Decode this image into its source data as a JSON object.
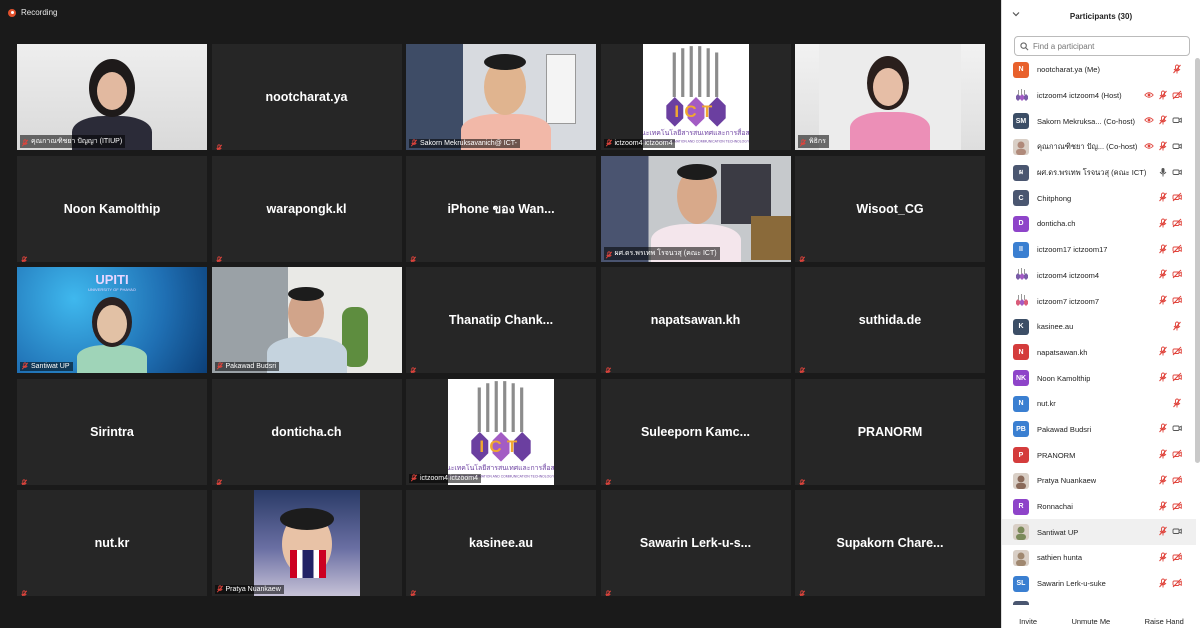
{
  "recording": {
    "label": "Recording"
  },
  "tiles": [
    {
      "name": "คุณกาณฑิชยา ปัญญา (ITIUP)",
      "kind": "video",
      "bg": "woman1"
    },
    {
      "name": "nootcharat.ya",
      "kind": "name"
    },
    {
      "name": "Sakorn Mekruksavanich@ ICT-",
      "kind": "video",
      "bg": "office"
    },
    {
      "name": "ictzoom4 ictzoom4",
      "kind": "logo"
    },
    {
      "name": "พิธิกร",
      "kind": "video",
      "bg": "woman2"
    },
    {
      "name": "Noon Kamolthip",
      "kind": "name"
    },
    {
      "name": "warapongk.kl",
      "kind": "name"
    },
    {
      "name": "iPhone ของ Wan...",
      "kind": "name"
    },
    {
      "name": "ผศ.ดร.พรเทพ โรจนวสุ (คณะ ICT)",
      "kind": "video",
      "bg": "man2",
      "active": true
    },
    {
      "name": "Wisoot_CG",
      "kind": "name"
    },
    {
      "name": "Santiwat UP",
      "kind": "video",
      "bg": "blue"
    },
    {
      "name": "Pakawad Budsri",
      "kind": "video",
      "bg": "room"
    },
    {
      "name": "Thanatip  Chank...",
      "kind": "name"
    },
    {
      "name": "napatsawan.kh",
      "kind": "name"
    },
    {
      "name": "suthida.de",
      "kind": "name"
    },
    {
      "name": "Sirintra",
      "kind": "name"
    },
    {
      "name": "donticha.ch",
      "kind": "name"
    },
    {
      "name": "ictzoom4 ictzoom4",
      "kind": "logo"
    },
    {
      "name": "Suleeporn  Kamc...",
      "kind": "name"
    },
    {
      "name": "PRANORM",
      "kind": "name"
    },
    {
      "name": "nut.kr",
      "kind": "name"
    },
    {
      "name": "Pratya Nuankaew",
      "kind": "video",
      "bg": "boy"
    },
    {
      "name": "kasinee.au",
      "kind": "name"
    },
    {
      "name": "Sawarin  Lerk-u-s...",
      "kind": "name"
    },
    {
      "name": "Supakorn  Chare...",
      "kind": "name"
    }
  ],
  "logo": {
    "letters": "ICT",
    "tagline": "คณะเทคโนโลยีสารสนเทศและการสื่อสาร",
    "sub": "SCHOOL OF INFORMATION AND COMMUNICATION TECHNOLOGY"
  },
  "upiti": {
    "title": "UPITI",
    "sub": "UNIVERSITY OF PHAYAO"
  },
  "panel": {
    "title": "Participants (30)",
    "search_placeholder": "Find a participant",
    "participants": [
      {
        "initials": "N",
        "color": "#e8612c",
        "name": "nootcharat.ya (Me)",
        "icons": [
          "mic-off"
        ]
      },
      {
        "initials": "",
        "color": "#7a5ca8",
        "name": "ictzoom4 ictzoom4 (Host)",
        "icons": [
          "eye",
          "mic-off",
          "cam-off"
        ],
        "logo": true
      },
      {
        "initials": "SM",
        "color": "#3c4e66",
        "name": "Sakorn Mekruksa... (Co-host)",
        "icons": [
          "eye",
          "mic-off",
          "cam"
        ]
      },
      {
        "initials": "",
        "color": "#b08a7a",
        "name": "คุณกาณฑิชยา ปัญ... (Co-host)",
        "icons": [
          "eye",
          "mic-off",
          "cam"
        ],
        "photo": true
      },
      {
        "initials": "ผ",
        "color": "#4a5670",
        "name": "ผศ.ดร.พรเทพ โรจนวสุ (คณะ ICT)",
        "icons": [
          "mic",
          "cam"
        ]
      },
      {
        "initials": "C",
        "color": "#4a5670",
        "name": "Chitphong",
        "icons": [
          "mic-off",
          "cam-off"
        ]
      },
      {
        "initials": "D",
        "color": "#8e44c9",
        "name": "donticha.ch",
        "icons": [
          "mic-off",
          "cam-off"
        ]
      },
      {
        "initials": "II",
        "color": "#3a7fd1",
        "name": "ictzoom17 ictzoom17",
        "icons": [
          "mic-off",
          "cam-off"
        ]
      },
      {
        "initials": "",
        "color": "#7a5ca8",
        "name": "ictzoom4 ictzoom4",
        "icons": [
          "mic-off",
          "cam-off"
        ],
        "logo": true
      },
      {
        "initials": "",
        "color": "#d95c7a",
        "name": "ictzoom7 ictzoom7",
        "icons": [
          "mic-off",
          "cam-off"
        ],
        "logo": true
      },
      {
        "initials": "K",
        "color": "#3c4e66",
        "name": "kasinee.au",
        "icons": [
          "mic-off"
        ]
      },
      {
        "initials": "N",
        "color": "#d43c3c",
        "name": "napatsawan.kh",
        "icons": [
          "mic-off",
          "cam-off"
        ]
      },
      {
        "initials": "NK",
        "color": "#8e44c9",
        "name": "Noon Kamolthip",
        "icons": [
          "mic-off",
          "cam-off"
        ]
      },
      {
        "initials": "N",
        "color": "#3a7fd1",
        "name": "nut.kr",
        "icons": [
          "mic-off"
        ]
      },
      {
        "initials": "PB",
        "color": "#3a7fd1",
        "name": "Pakawad Budsri",
        "icons": [
          "mic-off",
          "cam"
        ]
      },
      {
        "initials": "P",
        "color": "#d43c3c",
        "name": "PRANORM",
        "icons": [
          "mic-off",
          "cam-off"
        ]
      },
      {
        "initials": "",
        "color": "#8a6a5a",
        "name": "Pratya Nuankaew",
        "icons": [
          "mic-off",
          "cam-off"
        ],
        "photo": true
      },
      {
        "initials": "R",
        "color": "#8e44c9",
        "name": "Ronnachai",
        "icons": [
          "mic-off",
          "cam-off"
        ]
      },
      {
        "initials": "",
        "color": "#7b8a5a",
        "name": "Santiwat UP",
        "icons": [
          "mic-off",
          "cam"
        ],
        "photo": true,
        "highlight": true
      },
      {
        "initials": "",
        "color": "#a08870",
        "name": "sathien hunta",
        "icons": [
          "mic-off",
          "cam-off"
        ],
        "photo": true
      },
      {
        "initials": "SL",
        "color": "#3a7fd1",
        "name": "Sawarin Lerk-u-suke",
        "icons": [
          "mic-off",
          "cam-off"
        ]
      },
      {
        "initials": "",
        "color": "#4a5670",
        "name": "",
        "icons": []
      }
    ],
    "footer": {
      "invite": "Invite",
      "unmute": "Unmute Me",
      "raise": "Raise Hand"
    }
  }
}
